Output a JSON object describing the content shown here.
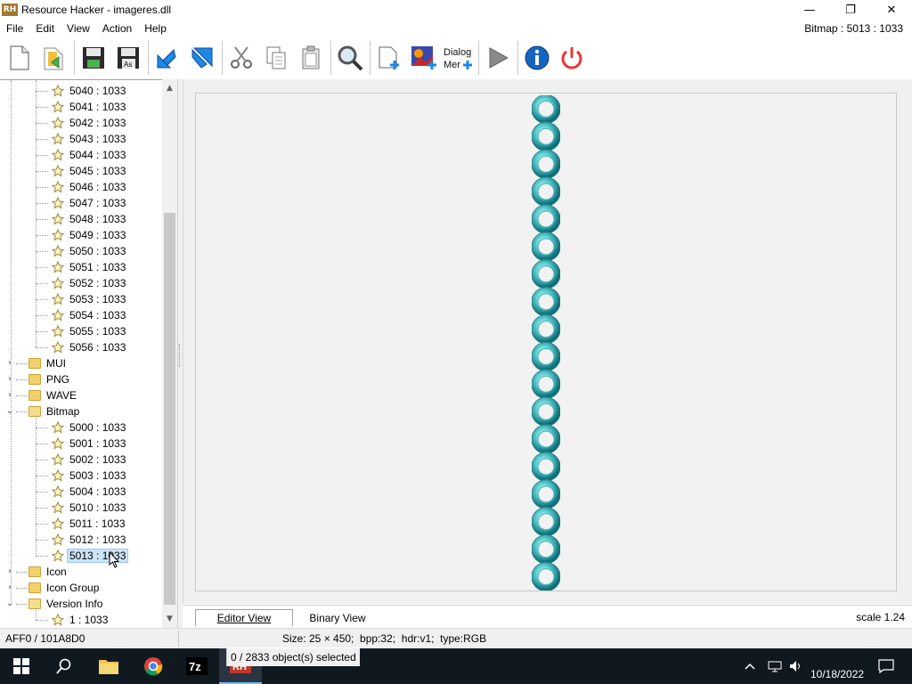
{
  "window": {
    "title": "Resource Hacker - imageres.dll",
    "logo_text": "RH",
    "minimize_glyph": "—",
    "maximize_glyph": "❐",
    "close_glyph": "✕"
  },
  "menu": {
    "items": [
      "File",
      "Edit",
      "View",
      "Action",
      "Help"
    ],
    "status": "Bitmap : 5013 : 1033"
  },
  "toolbar": {
    "buttons": [
      {
        "icon": "new-file-icon"
      },
      {
        "icon": "open-folder-icon"
      },
      {
        "icon": "save-icon"
      },
      {
        "icon": "save-as-icon",
        "label": "As"
      },
      {
        "icon": "back-arrow-icon"
      },
      {
        "icon": "forward-arrow-icon"
      },
      {
        "icon": "cut-icon"
      },
      {
        "icon": "copy-icon"
      },
      {
        "icon": "paste-icon"
      },
      {
        "icon": "search-icon"
      },
      {
        "icon": "add-resource-icon"
      },
      {
        "icon": "add-image-icon"
      },
      {
        "icon": "dialog-menu-icon",
        "label_line1": "Dialog",
        "label_line2": "Mer"
      },
      {
        "icon": "play-icon"
      },
      {
        "icon": "info-icon"
      },
      {
        "icon": "power-icon"
      }
    ]
  },
  "tree": {
    "bitmap_items_top": [
      "5040 : 1033",
      "5041 : 1033",
      "5042 : 1033",
      "5043 : 1033",
      "5044 : 1033",
      "5045 : 1033",
      "5046 : 1033",
      "5047 : 1033",
      "5048 : 1033",
      "5049 : 1033",
      "5050 : 1033",
      "5051 : 1033",
      "5052 : 1033",
      "5053 : 1033",
      "5054 : 1033",
      "5055 : 1033",
      "5056 : 1033"
    ],
    "folders_collapsed": [
      "MUI",
      "PNG",
      "WAVE"
    ],
    "bitmap_folder": "Bitmap",
    "bitmap_items": [
      "5000 : 1033",
      "5001 : 1033",
      "5002 : 1033",
      "5003 : 1033",
      "5004 : 1033",
      "5010 : 1033",
      "5011 : 1033",
      "5012 : 1033",
      "5013 : 1033"
    ],
    "selected_item": "5013 : 1033",
    "folders_after": [
      "Icon",
      "Icon Group"
    ],
    "version_folder": "Version Info",
    "version_items": [
      "1 : 1033"
    ]
  },
  "editor": {
    "ring_count": 18,
    "ring_color": "#2fb3b8"
  },
  "tabs": {
    "editor_view": "Editor View",
    "binary_view": "Binary View",
    "scale": "scale 1.24"
  },
  "statusbar": {
    "address": "AFF0 / 101A8D0",
    "info": "Size: 25 × 450;  bpp:32;  hdr:v1;  type:RGB",
    "selection": "0 / 2833 object(s) selected"
  },
  "taskbar": {
    "date": "10/18/2022",
    "apps": [
      "start-icon",
      "search-icon",
      "file-explorer-icon",
      "chrome-icon",
      "7zip-icon",
      "resource-hacker-icon"
    ],
    "sevenzip_label": "7z",
    "rh_label": "RH"
  }
}
